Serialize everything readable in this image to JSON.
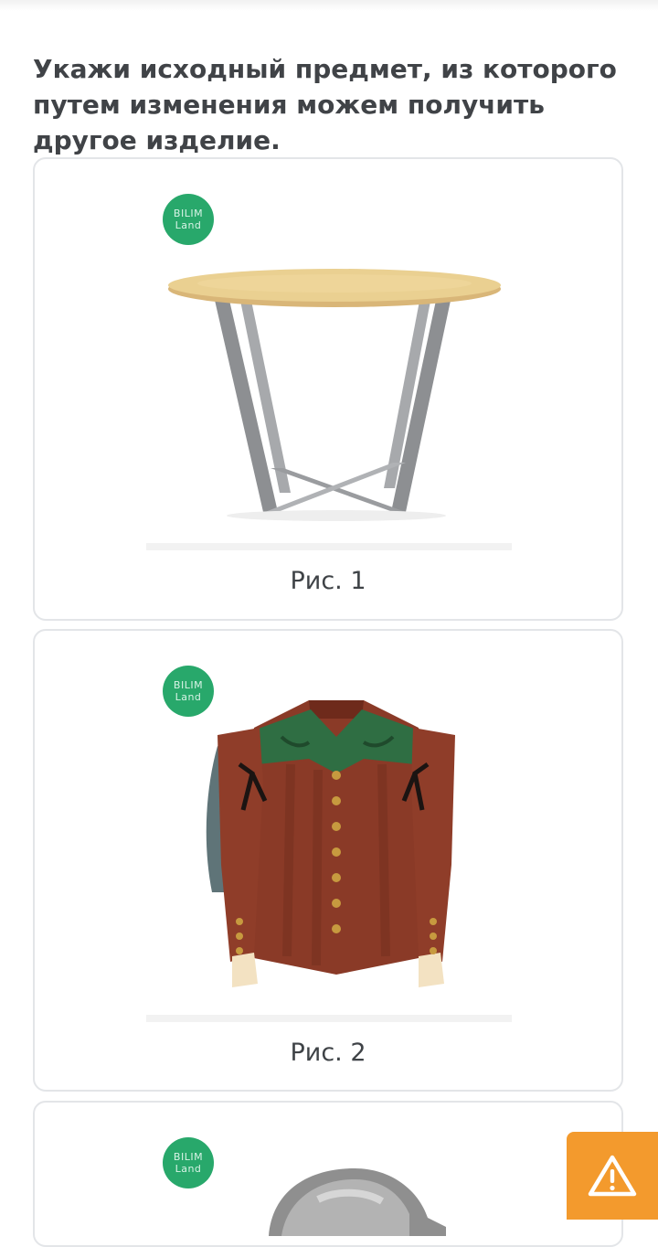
{
  "question": {
    "text": "Укажи исходный предмет, из которого путем изменения можем получить другое изделие."
  },
  "options": [
    {
      "caption": "Рис. 1",
      "image_icon": "table-icon",
      "badge": [
        "BILIM",
        "Land"
      ]
    },
    {
      "caption": "Рис. 2",
      "image_icon": "jacket-icon",
      "badge": [
        "BILIM",
        "Land"
      ]
    },
    {
      "caption": "",
      "image_icon": "helmet-icon",
      "badge": [
        "BILIM",
        "Land"
      ]
    }
  ],
  "report_button": {
    "icon": "warning-icon"
  },
  "colors": {
    "accent_orange": "#f39a2d",
    "badge_green": "#28a86b",
    "text": "#404347",
    "card_border": "#e3e5e8"
  }
}
